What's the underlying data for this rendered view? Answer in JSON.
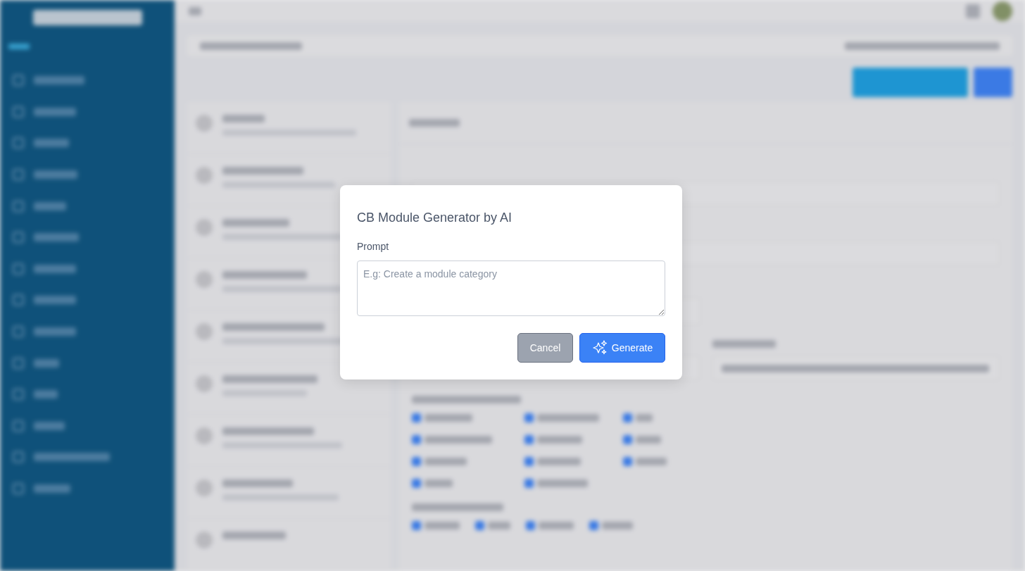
{
  "dialog": {
    "title": "CB Module Generator by AI",
    "label": "Prompt",
    "placeholder": "E.g: Create a module category",
    "cancel": "Cancel",
    "generate": "Generate"
  }
}
